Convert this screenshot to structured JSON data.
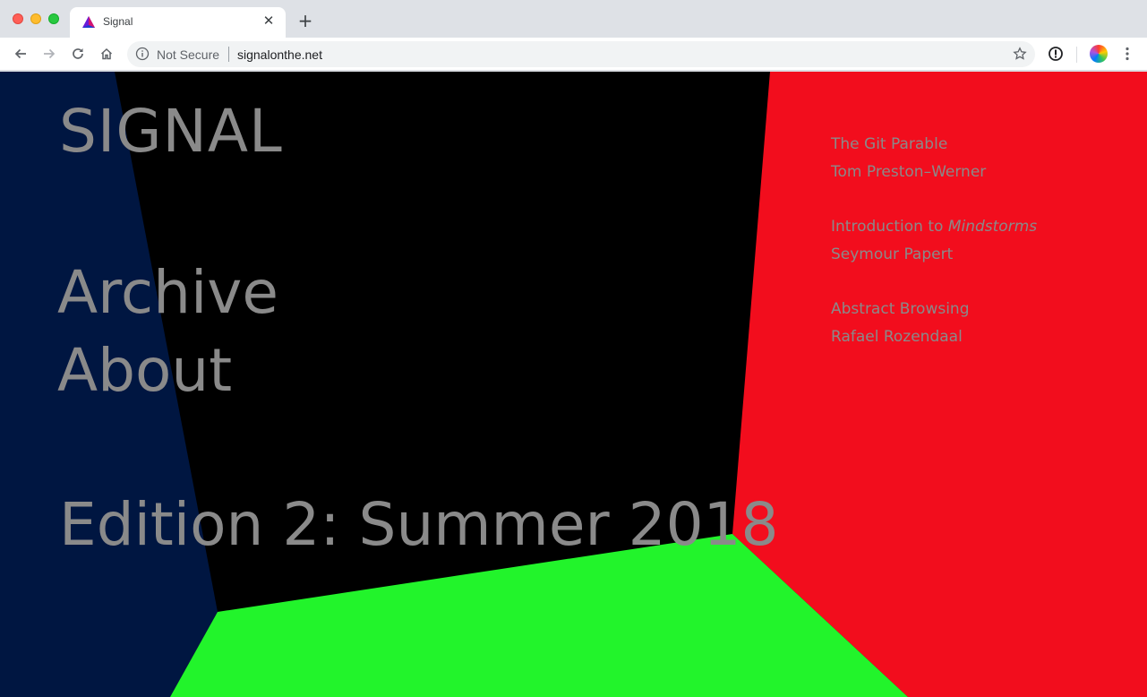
{
  "browser": {
    "tab": {
      "title": "Signal",
      "close_glyph": "✕",
      "favicon": "signal-favicon-icon"
    },
    "new_tab_glyph": "+",
    "omnibox": {
      "security_label": "Not Secure",
      "url": "signalonthe.net"
    },
    "icons": [
      "back-arrow-icon",
      "forward-arrow-icon",
      "reload-icon",
      "home-icon",
      "info-icon",
      "star-icon",
      "extension-icon",
      "avatar",
      "kebab-menu-icon"
    ]
  },
  "page": {
    "logo": "SIGNAL",
    "nav": {
      "archive": "Archive",
      "about": "About"
    },
    "edition": "Edition 2: Summer 2018",
    "articles": [
      {
        "title": "The Git Parable",
        "title_em": "",
        "author": "Tom Preston–Werner"
      },
      {
        "title": "Introduction to ",
        "title_em": "Mindstorms",
        "author": "Seymour Papert"
      },
      {
        "title": "Abstract Browsing",
        "title_em": "",
        "author": "Rafael Rozendaal"
      }
    ]
  },
  "colors": {
    "left_wall": "#001641",
    "back_wall": "#000000",
    "right_wall": "#f20d1d",
    "floor": "#22f42b",
    "text": "#8a8a8a"
  }
}
